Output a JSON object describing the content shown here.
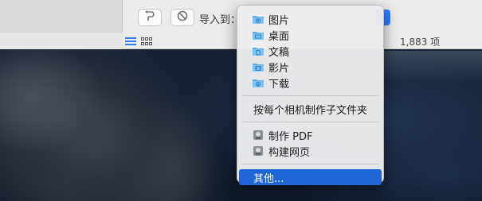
{
  "toolbar": {
    "import_label": "导入到：",
    "item_count": "1,883 项"
  },
  "menu": {
    "folders": [
      {
        "label": "图片",
        "icon": "pictures-folder-icon"
      },
      {
        "label": "桌面",
        "icon": "desktop-folder-icon"
      },
      {
        "label": "文稿",
        "icon": "documents-folder-icon"
      },
      {
        "label": "影片",
        "icon": "movies-folder-icon"
      },
      {
        "label": "下载",
        "icon": "downloads-folder-icon"
      }
    ],
    "per_camera": "按每个相机制作子文件夹",
    "apps": [
      {
        "label": "制作 PDF",
        "icon": "automator-icon"
      },
      {
        "label": "构建网页",
        "icon": "automator-icon"
      }
    ],
    "other": "其他..."
  },
  "colors": {
    "accent": "#1f65d6",
    "folder_blue": "#5aaeea"
  }
}
